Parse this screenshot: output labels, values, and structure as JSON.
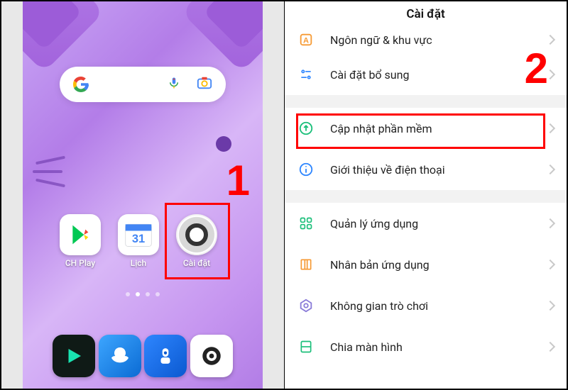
{
  "steps": {
    "one": "1",
    "two": "2"
  },
  "left": {
    "search": {
      "placeholder": ""
    },
    "apps": {
      "play": {
        "label": "CH Play"
      },
      "calendar": {
        "label": "Lịch",
        "day": "31"
      },
      "settings": {
        "label": "Cài đặt"
      }
    }
  },
  "right": {
    "title": "Cài đặt",
    "rows": {
      "language": {
        "label": "Ngôn ngữ & khu vực"
      },
      "additional": {
        "label": "Cài đặt bổ sung"
      },
      "software_update": {
        "label": "Cập nhật phần mềm"
      },
      "about_phone": {
        "label": "Giới thiệu về điện thoại"
      },
      "app_manage": {
        "label": "Quản lý ứng dụng"
      },
      "app_clone": {
        "label": "Nhân bản ứng dụng"
      },
      "game_space": {
        "label": "Không gian trò chơi"
      },
      "split_screen": {
        "label": "Chia màn hình"
      }
    }
  },
  "colors": {
    "highlight": "#ff0000",
    "accent_green": "#1bbf7a",
    "accent_orange": "#f69a34",
    "accent_blue": "#2e86ff"
  }
}
